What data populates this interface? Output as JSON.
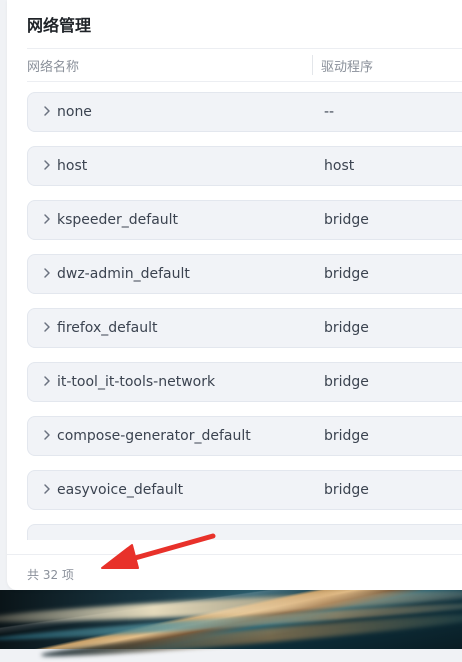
{
  "panel": {
    "title": "网络管理",
    "columns": {
      "name": "网络名称",
      "driver": "驱动程序"
    },
    "rows": [
      {
        "name": "none",
        "driver": "--"
      },
      {
        "name": "host",
        "driver": "host"
      },
      {
        "name": "kspeeder_default",
        "driver": "bridge"
      },
      {
        "name": "dwz-admin_default",
        "driver": "bridge"
      },
      {
        "name": "firefox_default",
        "driver": "bridge"
      },
      {
        "name": "it-tool_it-tools-network",
        "driver": "bridge"
      },
      {
        "name": "compose-generator_default",
        "driver": "bridge"
      },
      {
        "name": "easyvoice_default",
        "driver": "bridge"
      }
    ],
    "footer": "共 32 项"
  },
  "icons": {
    "row_expand": "chevron-right-icon",
    "annotation": "red-arrow-icon"
  },
  "colors": {
    "row_bg": "#f1f3f7",
    "arrow": "#e8312a"
  }
}
